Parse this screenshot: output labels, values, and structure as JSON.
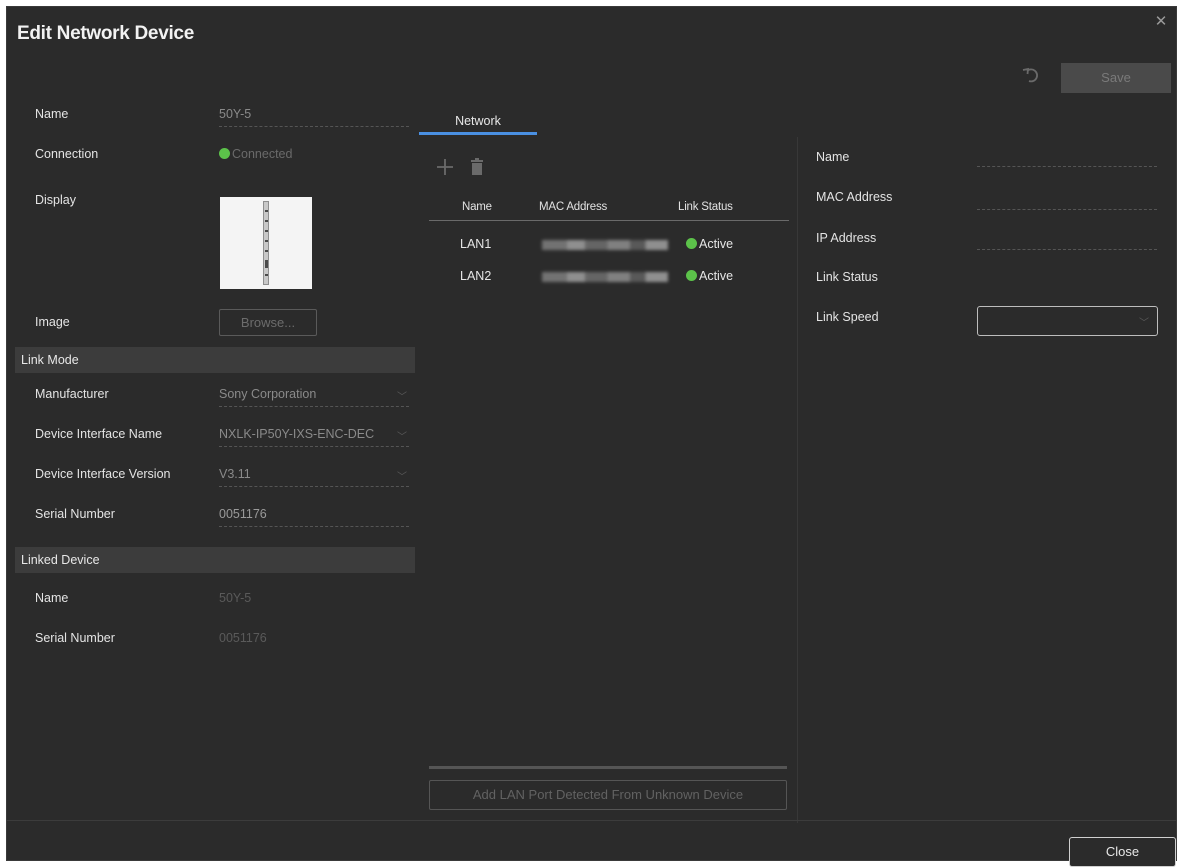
{
  "dialog": {
    "title": "Edit Network Device",
    "save_label": "Save",
    "close_label": "Close"
  },
  "device": {
    "name_label": "Name",
    "name_value": "50Y-5",
    "connection_label": "Connection",
    "connection_value": "Connected",
    "display_label": "Display",
    "image_label": "Image",
    "browse_label": "Browse..."
  },
  "link_mode": {
    "header": "Link Mode",
    "manufacturer_label": "Manufacturer",
    "manufacturer_value": "Sony Corporation",
    "interface_name_label": "Device Interface Name",
    "interface_name_value": "NXLK-IP50Y-IXS-ENC-DEC",
    "interface_version_label": "Device Interface Version",
    "interface_version_value": "V3.11",
    "serial_label": "Serial Number",
    "serial_value": "0051176"
  },
  "linked_device": {
    "header": "Linked Device",
    "name_label": "Name",
    "name_value": "50Y-5",
    "serial_label": "Serial Number",
    "serial_value": "0051176"
  },
  "network": {
    "tab_label": "Network",
    "columns": [
      "Name",
      "MAC Address",
      "Link Status"
    ],
    "rows": [
      {
        "name": "LAN1",
        "status": "Active"
      },
      {
        "name": "LAN2",
        "status": "Active"
      }
    ],
    "add_lan_label": "Add LAN Port Detected From Unknown Device"
  },
  "port_details": {
    "name_label": "Name",
    "mac_label": "MAC Address",
    "ip_label": "IP Address",
    "link_status_label": "Link Status",
    "link_speed_label": "Link Speed"
  },
  "colors": {
    "background": "#2b2b2b",
    "accent": "#4a90e2",
    "status_active": "#5cc24a"
  }
}
